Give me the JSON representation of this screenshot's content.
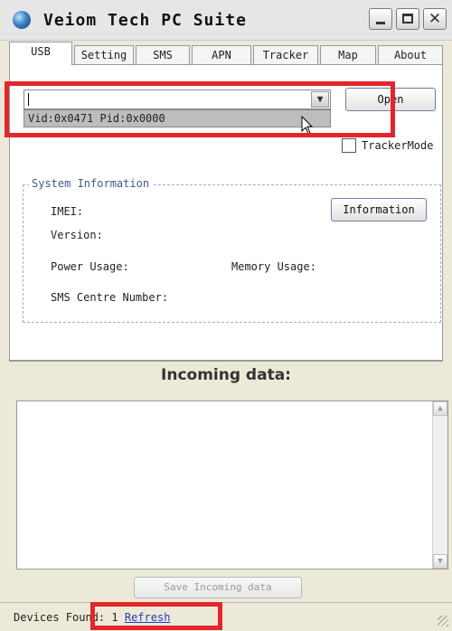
{
  "window": {
    "title": "Veiom Tech PC Suite",
    "icons": {
      "app": "globe-icon",
      "minimize": "minimize-icon",
      "maximize": "maximize-icon",
      "close": "close-icon"
    },
    "close_glyph": "✕"
  },
  "tabs": [
    {
      "label": "USB",
      "active": true
    },
    {
      "label": "Setting",
      "active": false
    },
    {
      "label": "SMS",
      "active": false
    },
    {
      "label": "APN",
      "active": false
    },
    {
      "label": "Tracker",
      "active": false
    },
    {
      "label": "Map",
      "active": false
    },
    {
      "label": "About",
      "active": false
    }
  ],
  "usb": {
    "device_combo_value": "",
    "dropdown_option": "Vid:0x0471 Pid:0x0000",
    "open_button": "Open",
    "tracker_mode_label": "TrackerMode",
    "tracker_mode_checked": false
  },
  "system_info": {
    "group_title": "System Information",
    "imei_label": "IMEI:",
    "version_label": "Version:",
    "power_label": "Power Usage:",
    "memory_label": "Memory Usage:",
    "sms_centre_label": "SMS Centre Number:",
    "information_button": "Information"
  },
  "incoming": {
    "title": "Incoming data:",
    "text": "",
    "save_button": "Save Incoming data"
  },
  "status": {
    "devices_found_label": "Devices Found:",
    "devices_found_count": "1",
    "refresh_link": "Refresh"
  },
  "colors": {
    "highlight": "#e3262b",
    "link": "#1a3cc4",
    "group_title": "#3c5a8c"
  }
}
